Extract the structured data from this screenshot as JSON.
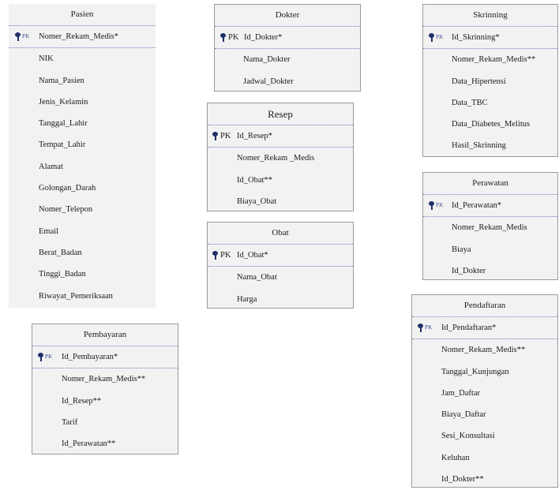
{
  "entities": {
    "pasien": {
      "title": "Pasien",
      "pk_label": "PK",
      "pk": "Nomer_Rekam_Medis*",
      "fields": [
        "NIK",
        "Nama_Pasien",
        "Jenis_Kelamin",
        "Tanggal_Lahir",
        "Tempat_Lahir",
        "Alamat",
        "Golongan_Darah",
        "Nomer_Telepon",
        "Email",
        "Berat_Badan",
        "Tinggi_Badan",
        "Riwayat_Pemeriksaan"
      ]
    },
    "dokter": {
      "title": "Dokter",
      "pk_label": "PK",
      "pk": "Id_Dokter*",
      "fields": [
        "Nama_Dokter",
        "Jadwal_Dokter"
      ]
    },
    "resep": {
      "title": "Resep",
      "pk_label": "PK",
      "pk": "Id_Resep*",
      "fields": [
        "Nomer_Rekam _Medis",
        "Id_Obat**",
        "Biaya_Obat"
      ]
    },
    "obat": {
      "title": "Obat",
      "pk_label": "PK",
      "pk": "Id_Obat*",
      "fields": [
        "Nama_Obat",
        "Harga"
      ]
    },
    "skrinning": {
      "title": "Skrinning",
      "pk_label": "PK",
      "pk": "Id_Skrinning*",
      "fields": [
        "Nomer_Rekam_Medis**",
        "Data_Hipertensi",
        "Data_TBC",
        "Data_Diabetes_Melitus",
        "Hasil_Skrinning"
      ]
    },
    "perawatan": {
      "title": "Perawatan",
      "pk_label": "PK",
      "pk": "Id_Perawatan*",
      "fields": [
        "Nomer_Rekam_Medis",
        "Biaya",
        "Id_Dokter"
      ]
    },
    "pendaftaran": {
      "title": "Pendaftaran",
      "pk_label": "PK",
      "pk": "Id_Pendaftaran*",
      "fields": [
        "Nomer_Rekam_Medis**",
        "Tanggal_Kunjungan",
        "Jam_Daftar",
        "Biaya_Daftar",
        "Sesi_Konsultasi",
        "Keluhan",
        "Id_Dokter**"
      ]
    },
    "pembayaran": {
      "title": "Pembayaran",
      "pk_label": "PK",
      "pk": "Id_Pembayaran*",
      "fields": [
        "Nomer_Rekam_Medis**",
        "Id_Resep**",
        "Tarif",
        "Id_Perawatan**"
      ]
    }
  }
}
